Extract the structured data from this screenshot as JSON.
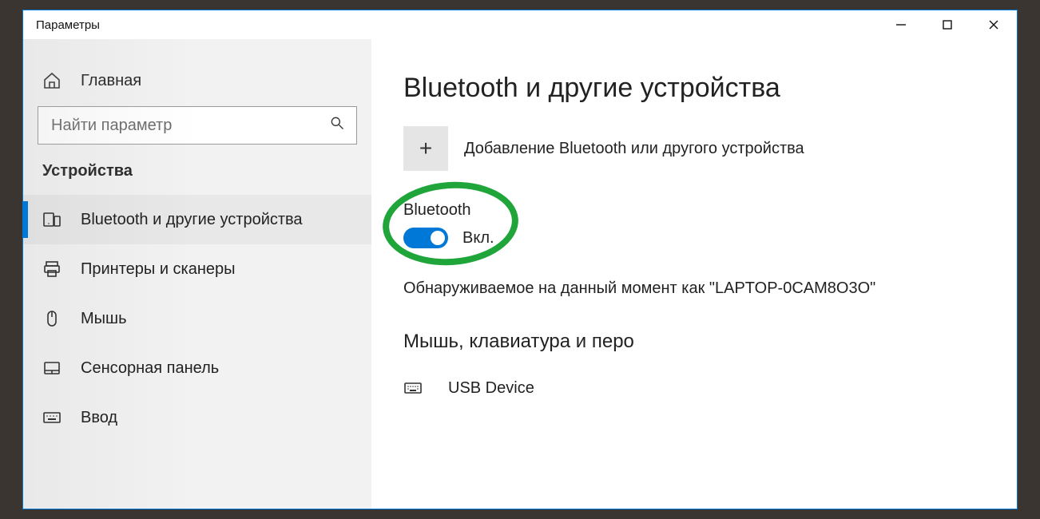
{
  "window": {
    "title": "Параметры"
  },
  "sidebar": {
    "home_label": "Главная",
    "search_placeholder": "Найти параметр",
    "section_label": "Устройства",
    "items": [
      {
        "label": "Bluetooth и другие устройства",
        "icon": "devices"
      },
      {
        "label": "Принтеры и сканеры",
        "icon": "printer"
      },
      {
        "label": "Мышь",
        "icon": "mouse"
      },
      {
        "label": "Сенсорная панель",
        "icon": "touchpad"
      },
      {
        "label": "Ввод",
        "icon": "keyboard"
      }
    ]
  },
  "main": {
    "page_title": "Bluetooth и другие устройства",
    "add_device_label": "Добавление Bluetooth или другого устройства",
    "bluetooth": {
      "label": "Bluetooth",
      "state_text": "Вкл.",
      "state_on": true
    },
    "discoverable_text": "Обнаруживаемое на данный момент как \"LAPTOP-0CAM8O3O\"",
    "section_mouse_kb": "Мышь, клавиатура и перо",
    "devices": [
      {
        "label": "USB Device",
        "icon": "keyboard"
      }
    ]
  }
}
